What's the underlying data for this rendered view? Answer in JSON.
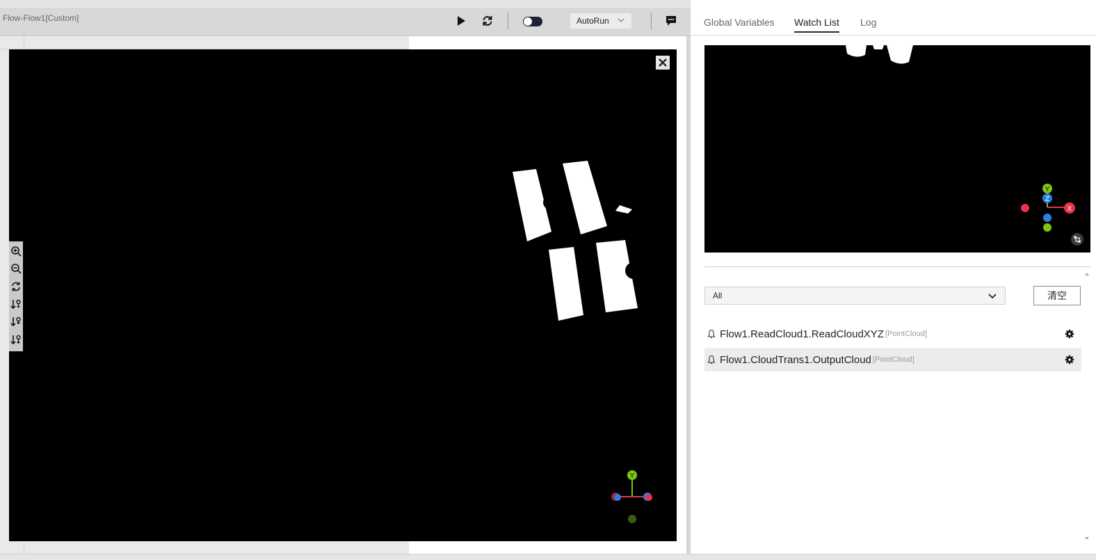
{
  "flow": {
    "title": "Flow-Flow1[Custom]",
    "autorun_label": "AutoRun",
    "run_mode_toggle_on": false
  },
  "viewer": {
    "axis_labels": {
      "y": "Y",
      "x": "X",
      "z": "Z"
    }
  },
  "right_panel": {
    "tabs": [
      {
        "label": "Global Variables",
        "active": false
      },
      {
        "label": "Watch List",
        "active": true
      },
      {
        "label": "Log",
        "active": false
      }
    ],
    "filter_value": "All",
    "clear_label": "清空",
    "watch_items": [
      {
        "name": "Flow1.ReadCloud1.ReadCloudXYZ",
        "type": "[PointCloud]",
        "selected": false
      },
      {
        "name": "Flow1.CloudTrans1.OutputCloud",
        "type": "[PointCloud]",
        "selected": true
      }
    ]
  },
  "colors": {
    "axis_red": "#e8334a",
    "axis_green": "#7ec610",
    "axis_blue": "#2f7fe0",
    "toggle_dark": "#1b2233"
  },
  "icons": [
    "play-icon",
    "refresh-icon",
    "chevron-down-icon",
    "comment-icon",
    "close-icon",
    "zoom-in-icon",
    "zoom-out-icon",
    "reset-view-icon",
    "view-sort-icon",
    "expand-icon",
    "bell-icon",
    "gear-icon"
  ]
}
